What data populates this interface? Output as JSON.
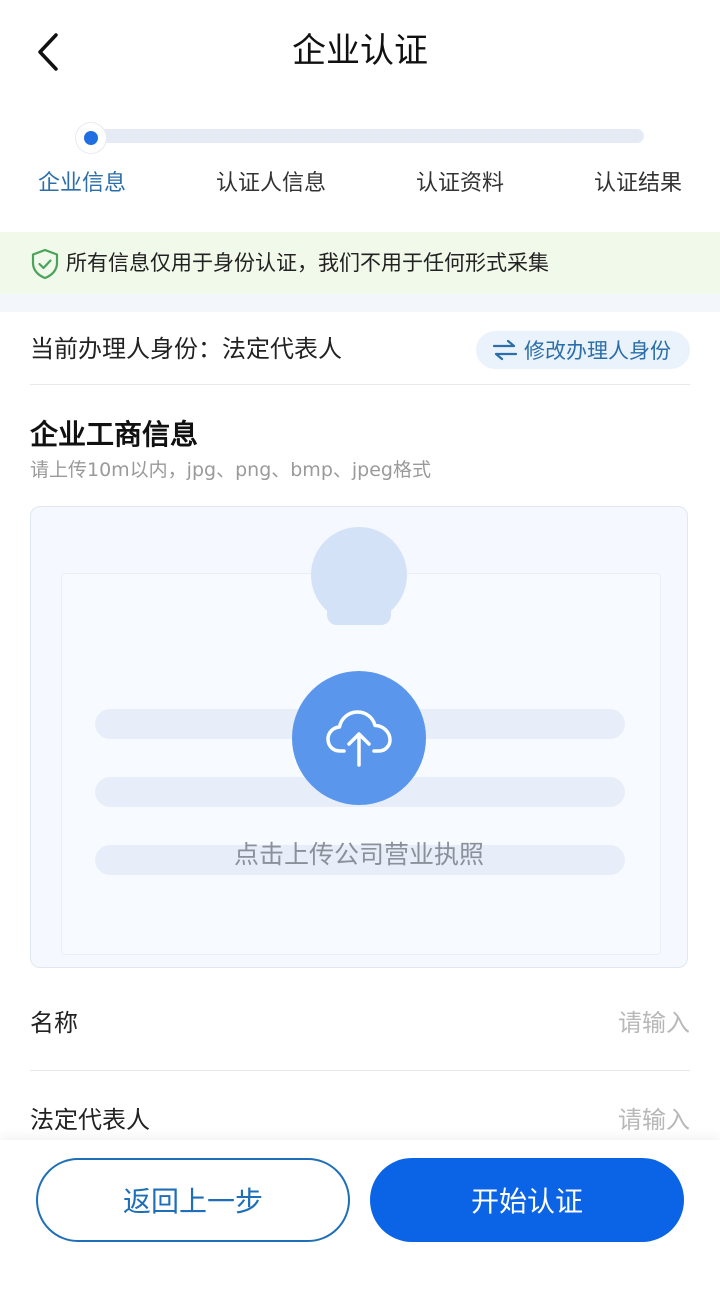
{
  "header": {
    "title": "企业认证",
    "back_icon": "chevron-left-icon"
  },
  "stepper": {
    "current_index": 0,
    "progress_fraction": 0.0,
    "steps": [
      {
        "label": "企业信息",
        "active": true
      },
      {
        "label": "认证人信息",
        "active": false
      },
      {
        "label": "认证资料",
        "active": false
      },
      {
        "label": "认证结果",
        "active": false
      }
    ]
  },
  "notice": {
    "icon": "shield-check-icon",
    "text": "所有信息仅用于身份认证，我们不用于任何形式采集"
  },
  "identity": {
    "label": "当前办理人身份：法定代表人",
    "change_button": "修改办理人身份",
    "change_icon": "swap-arrows-icon"
  },
  "section": {
    "title": "企业工商信息",
    "hint": "请上传10m以内，jpg、png、bmp、jpeg格式"
  },
  "upload": {
    "icon": "cloud-upload-icon",
    "caption": "点击上传公司营业执照"
  },
  "form": {
    "fields": [
      {
        "label": "名称",
        "placeholder": "请输入",
        "value": ""
      },
      {
        "label": "法定代表人",
        "placeholder": "请输入",
        "value": ""
      }
    ]
  },
  "actions": {
    "back_label": "返回上一步",
    "start_label": "开始认证"
  },
  "colors": {
    "primary": "#0b63e5",
    "accent_text": "#2c6ea8",
    "notice_bg": "#f1f9ea",
    "upload_circle": "#5a97ec"
  }
}
